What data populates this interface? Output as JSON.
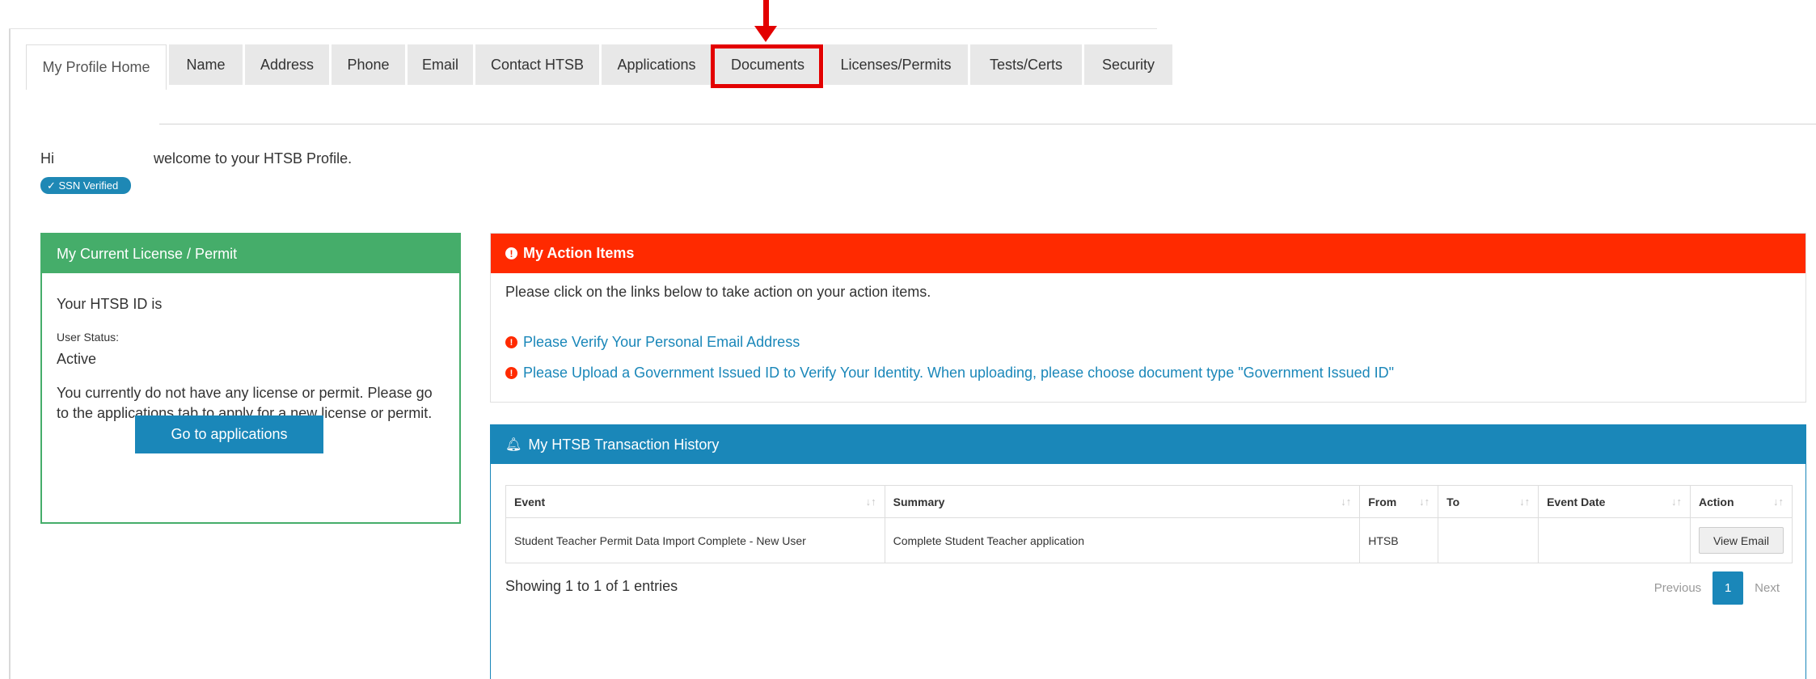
{
  "colors": {
    "annotation": "#e30000",
    "license_panel": "#45ad6a",
    "action_panel": "#ff2a00",
    "history_panel": "#1a87b9",
    "link": "#1a87b9"
  },
  "tabs": [
    {
      "label": "My Profile Home",
      "active": true
    },
    {
      "label": "Name"
    },
    {
      "label": "Address"
    },
    {
      "label": "Phone"
    },
    {
      "label": "Email"
    },
    {
      "label": "Contact HTSB"
    },
    {
      "label": "Applications"
    },
    {
      "label": "Documents",
      "highlighted": true
    },
    {
      "label": "Licenses/Permits"
    },
    {
      "label": "Tests/Certs"
    },
    {
      "label": "Security"
    }
  ],
  "greeting": {
    "hi": "Hi",
    "welcome": "welcome to your HTSB Profile.",
    "badge": "✓ SSN Verified"
  },
  "license_panel": {
    "title": "My Current License / Permit",
    "id_label": "Your HTSB ID is",
    "status_label": "User Status:",
    "status_value": "Active",
    "message": "You currently do not have any license or permit. Please go to the applications tab to apply for a new license or permit.",
    "button": "Go to applications"
  },
  "action_items": {
    "title": "My Action Items",
    "intro": "Please click on the links below to take action on your action items.",
    "links": [
      "Please Verify Your Personal Email Address",
      "Please Upload a Government Issued ID to Verify Your Identity. When uploading, please choose document type \"Government Issued ID\""
    ]
  },
  "transaction_history": {
    "title": "My HTSB Transaction History",
    "columns": [
      "Event",
      "Summary",
      "From",
      "To",
      "Event Date",
      "Action"
    ],
    "rows": [
      {
        "event": "Student Teacher Permit Data Import Complete - New User",
        "summary": "Complete Student Teacher application",
        "from": "HTSB",
        "to": "",
        "event_date": "",
        "action": "View Email"
      }
    ],
    "info": "Showing 1 to 1 of 1 entries",
    "pager": {
      "previous": "Previous",
      "current": "1",
      "next": "Next"
    }
  }
}
